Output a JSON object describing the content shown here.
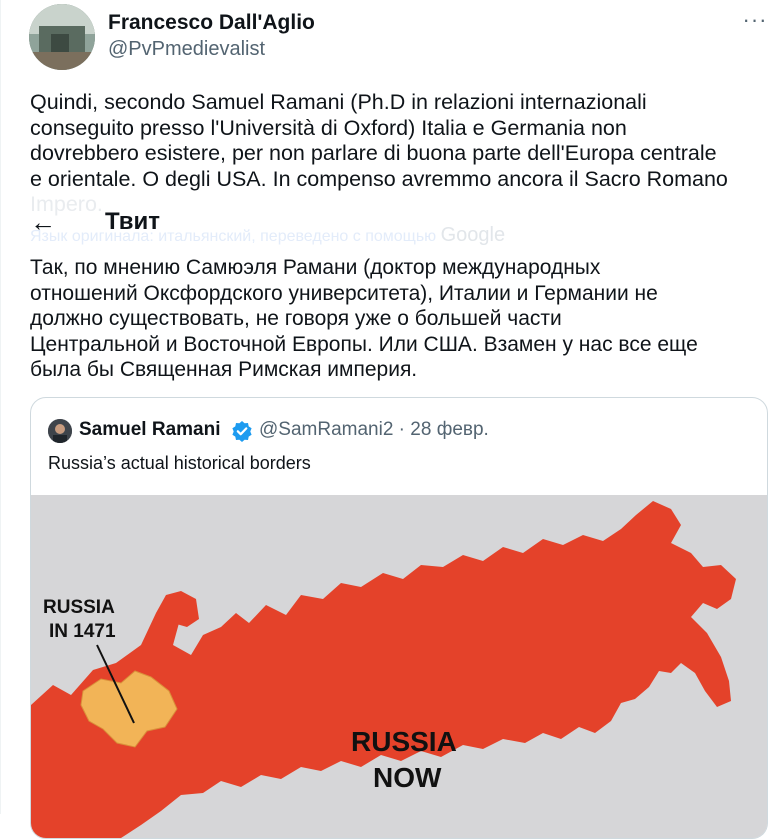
{
  "author": {
    "display_name": "Francesco Dall'Aglio",
    "handle": "@PvPmedievalist"
  },
  "more_icon": "···",
  "tweet": {
    "lines": [
      "Quindi, secondo Samuel Ramani (Ph.D in relazioni internazionali",
      "conseguito presso l'Università di Oxford) Italia e Germania non",
      "dovrebbero esistere, per non parlare di buona parte dell'Europa centrale",
      "e orientale. O degli USA. In compenso avremmo ancora il Sacro Romano"
    ],
    "faded_line": "Impero."
  },
  "overlay_header": {
    "back_icon": "←",
    "title": "Твит",
    "translated_note": "Язык оригинала: итальянский, переведено с помощью",
    "google_logo": "Google"
  },
  "translation": {
    "lines": [
      "Так, по мнению Самюэля Рамани (доктор международных",
      "отношений Оксфордского университета), Италии и Германии не",
      "должно существовать, не говоря уже о большей части",
      "Центральной и Восточной Европы. Или США. Взамен у нас все еще",
      "была бы Священная Римская империя."
    ]
  },
  "quoted_tweet": {
    "name": "Samuel Ramani",
    "handle_date": "@SamRamani2 · 28 февр.",
    "text": "Russia’s actual historical borders",
    "map": {
      "label_1471_line1": "RUSSIA",
      "label_1471_line2": "IN 1471",
      "label_now_line1": "RUSSIA",
      "label_now_line2": "NOW"
    }
  },
  "colors": {
    "russia_now": "#e4422a",
    "russia_1471": "#f2b457",
    "background_sea": "#d6d6d8",
    "handle_gray": "#536471",
    "verified_blue": "#1d9bf0"
  }
}
